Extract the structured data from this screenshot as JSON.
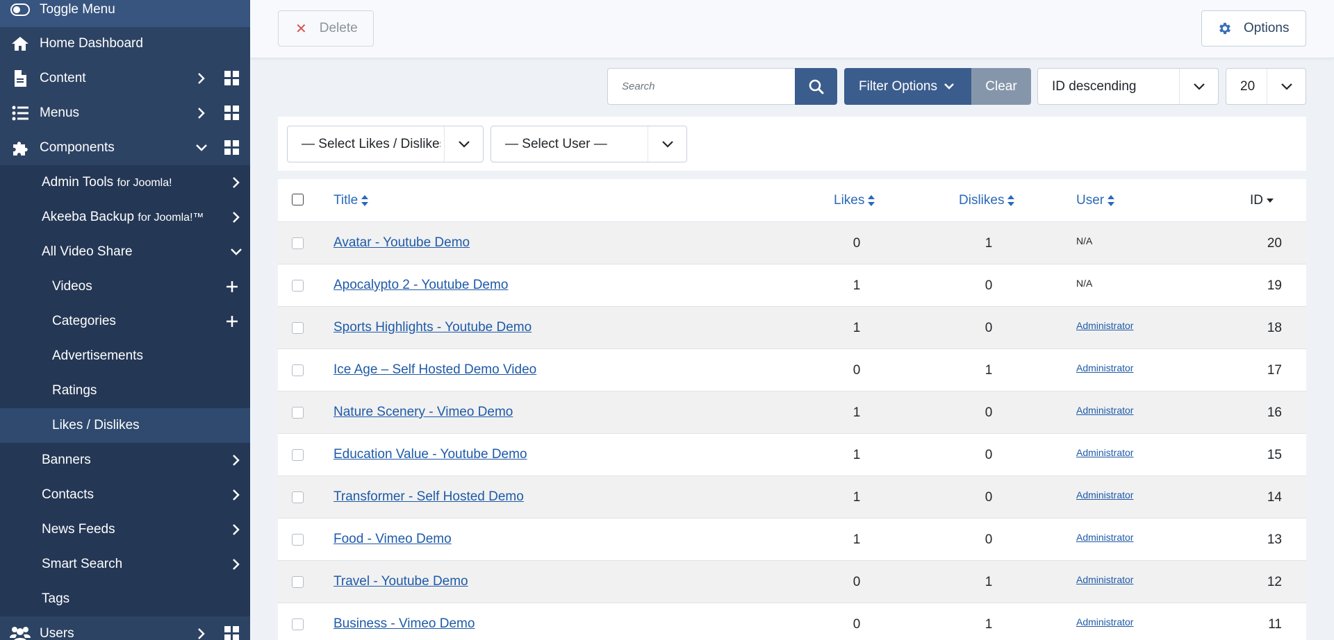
{
  "sidebar": {
    "toggle_label": "Toggle Menu",
    "home_label": "Home Dashboard",
    "content_label": "Content",
    "menus_label": "Menus",
    "components_label": "Components",
    "admin_tools_label": "Admin Tools",
    "admin_tools_suffix": "for Joomla!",
    "akeeba_label": "Akeeba Backup",
    "akeeba_suffix": "for Joomla!™",
    "avs_label": "All Video Share",
    "videos_label": "Videos",
    "categories_label": "Categories",
    "advertisements_label": "Advertisements",
    "ratings_label": "Ratings",
    "likes_label": "Likes / Dislikes",
    "banners_label": "Banners",
    "contacts_label": "Contacts",
    "newsfeeds_label": "News Feeds",
    "smartsearch_label": "Smart Search",
    "tags_label": "Tags",
    "users_label": "Users"
  },
  "toolbar": {
    "delete_label": "Delete",
    "options_label": "Options"
  },
  "search": {
    "placeholder": "Search",
    "filter_options_label": "Filter Options",
    "clear_label": "Clear",
    "ordering_value": "ID descending",
    "limit_value": "20"
  },
  "filters": {
    "likes_select": "— Select Likes / Dislikes —",
    "user_select": "— Select User —"
  },
  "table": {
    "headers": {
      "title": "Title",
      "likes": "Likes",
      "dislikes": "Dislikes",
      "user": "User",
      "id": "ID"
    },
    "rows": [
      {
        "title": "Avatar - Youtube Demo",
        "likes": "0",
        "dislikes": "1",
        "user": "N/A",
        "id": "20"
      },
      {
        "title": "Apocalypto 2 - Youtube Demo",
        "likes": "1",
        "dislikes": "0",
        "user": "N/A",
        "id": "19"
      },
      {
        "title": "Sports Highlights - Youtube Demo",
        "likes": "1",
        "dislikes": "0",
        "user": "Administrator",
        "id": "18"
      },
      {
        "title": "Ice Age – Self Hosted Demo Video",
        "likes": "0",
        "dislikes": "1",
        "user": "Administrator",
        "id": "17"
      },
      {
        "title": "Nature Scenery - Vimeo Demo",
        "likes": "1",
        "dislikes": "0",
        "user": "Administrator",
        "id": "16"
      },
      {
        "title": "Education Value - Youtube Demo",
        "likes": "1",
        "dislikes": "0",
        "user": "Administrator",
        "id": "15"
      },
      {
        "title": "Transformer - Self Hosted Demo",
        "likes": "1",
        "dislikes": "0",
        "user": "Administrator",
        "id": "14"
      },
      {
        "title": "Food - Vimeo Demo",
        "likes": "1",
        "dislikes": "0",
        "user": "Administrator",
        "id": "13"
      },
      {
        "title": "Travel - Youtube Demo",
        "likes": "0",
        "dislikes": "1",
        "user": "Administrator",
        "id": "12"
      },
      {
        "title": "Business - Vimeo Demo",
        "likes": "0",
        "dislikes": "1",
        "user": "Administrator",
        "id": "11"
      }
    ]
  },
  "colors": {
    "sidebar_bg": "#2d4363",
    "primary": "#3b5d8d",
    "link": "#1e5aa8"
  }
}
